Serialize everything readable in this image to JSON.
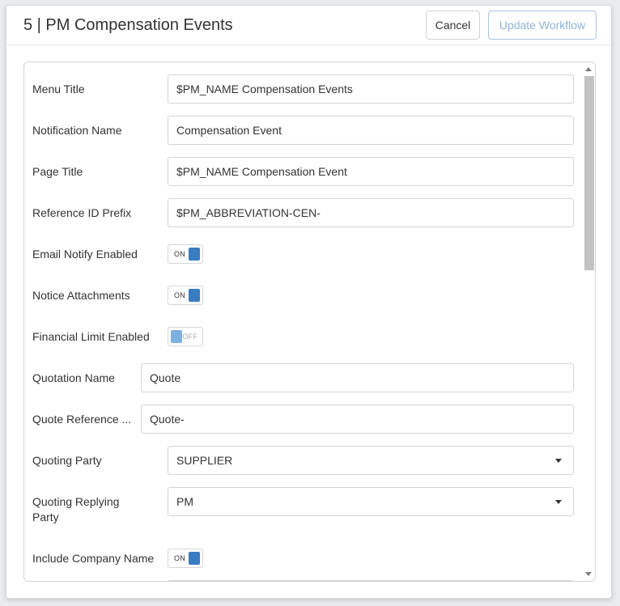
{
  "modal": {
    "title": "5 | PM Compensation Events",
    "cancel_label": "Cancel",
    "update_label": "Update Workflow"
  },
  "form": {
    "menu_title": {
      "label": "Menu Title",
      "value": "$PM_NAME Compensation Events"
    },
    "notification_name": {
      "label": "Notification Name",
      "value": "Compensation Event"
    },
    "page_title": {
      "label": "Page Title",
      "value": "$PM_NAME Compensation Event"
    },
    "reference_id_prefix": {
      "label": "Reference ID Prefix",
      "value": "$PM_ABBREVIATION-CEN-"
    },
    "email_notify_enabled": {
      "label": "Email Notify Enabled",
      "state": "ON"
    },
    "notice_attachments": {
      "label": "Notice Attachments",
      "state": "ON"
    },
    "financial_limit_enabled": {
      "label": "Financial Limit Enabled",
      "state": "OFF"
    },
    "quotation_name": {
      "label": "Quotation Name",
      "value": "Quote"
    },
    "quote_reference": {
      "label": "Quote Reference ...",
      "value": "Quote-"
    },
    "quoting_party": {
      "label": "Quoting Party",
      "value": "SUPPLIER"
    },
    "quoting_replying_party": {
      "label_line1": "Quoting Replying",
      "label_line2": "Party",
      "value": "PM"
    },
    "include_company_name": {
      "label": "Include Company Name",
      "state": "ON"
    }
  },
  "colors": {
    "accent": "#3a7cc1",
    "toggle_off_knob": "#7fb0e0",
    "update_button_text": "#8fb2d8"
  },
  "icons": {
    "select_caret": "caret-down-icon",
    "scroll_up": "scroll-up-arrow-icon",
    "scroll_down": "scroll-down-arrow-icon"
  }
}
